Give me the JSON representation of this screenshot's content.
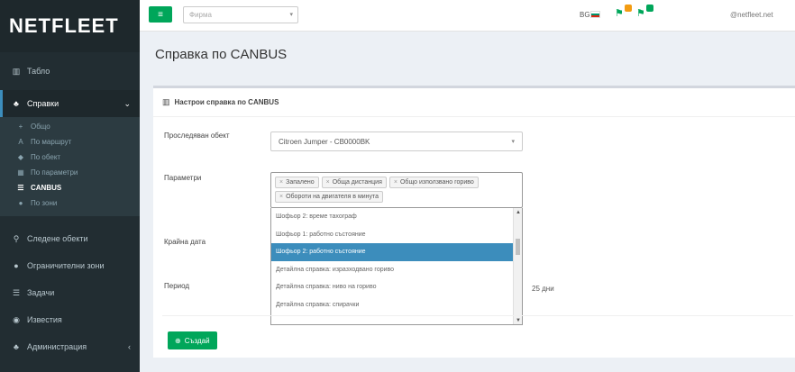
{
  "brand": "NETFLEET",
  "sidebar": {
    "items_top": [
      {
        "label": "Табло",
        "icon": "chart-icon"
      }
    ],
    "open_item": {
      "label": "Справки",
      "icon": "report-icon"
    },
    "submenu": [
      {
        "label": "Общо",
        "icon": "plus-icon",
        "active": false
      },
      {
        "label": "По маршрут",
        "icon": "road-icon",
        "active": false
      },
      {
        "label": "По обект",
        "icon": "pin-icon",
        "active": false
      },
      {
        "label": "По параметри",
        "icon": "table-icon",
        "active": false
      },
      {
        "label": "CANBUS",
        "icon": "list-icon",
        "active": true
      },
      {
        "label": "По зони",
        "icon": "dot-icon",
        "active": false
      }
    ],
    "items_bottom": [
      {
        "label": "Следене обекти",
        "icon": "location-icon"
      },
      {
        "label": "Ограничителни зони",
        "icon": "globe-icon"
      },
      {
        "label": "Задачи",
        "icon": "list-icon"
      },
      {
        "label": "Известия",
        "icon": "bell-icon"
      },
      {
        "label": "Администрация",
        "icon": "users-icon"
      }
    ]
  },
  "topbar": {
    "toggle_glyph": "≡",
    "select_placeholder": "Фирма",
    "lang": "BG",
    "user": "@netfleet.net"
  },
  "page": {
    "title": "Справка по CANBUS",
    "box_title": "Настрои справка по CANBUS",
    "tracked_object_label": "Проследяван обект",
    "tracked_object_value": "Citroen Jumper - CB0000BK",
    "params_label": "Параметри",
    "param_chips": [
      "Запалено",
      "Обща дистанция",
      "Общо използвано гориво",
      "Обороти на двигателя в минута"
    ],
    "dropdown_options": [
      {
        "label": "Шофьор 2: време тахограф",
        "highlighted": false
      },
      {
        "label": "Шофьор 1: работно състояние",
        "highlighted": false
      },
      {
        "label": "Шофьор 2: работно състояние",
        "highlighted": true
      },
      {
        "label": "Детайлна справка: изразходвано гориво",
        "highlighted": false
      },
      {
        "label": "Детайлна справка: ниво на гориво",
        "highlighted": false
      },
      {
        "label": "Детайлна справка: спирачки",
        "highlighted": false
      }
    ],
    "end_date_label": "Крайна дата",
    "period_label": "Период",
    "period_days": "25 дни",
    "create_button": "Създай"
  },
  "colors": {
    "sidebar_bg": "#222d32",
    "accent_green": "#00a65a",
    "highlight_blue": "#3c8dbc"
  }
}
